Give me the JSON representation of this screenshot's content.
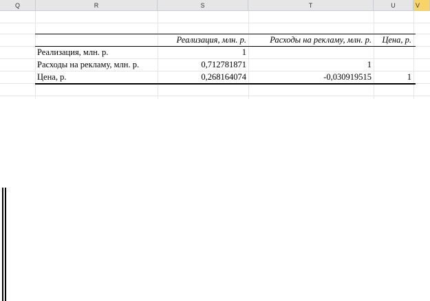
{
  "columns": [
    "Q",
    "R",
    "S",
    "T",
    "U",
    "V"
  ],
  "table": {
    "headers": [
      "",
      "Реализация, млн. р.",
      "Расходы на рекламу, млн. р.",
      "Цена, р."
    ],
    "rows": [
      {
        "label": "Реализация, млн. р.",
        "cells": [
          "1",
          "",
          ""
        ]
      },
      {
        "label": "Расходы на рекламу, млн. р.",
        "cells": [
          "0,712781871",
          "1",
          ""
        ]
      },
      {
        "label": "Цена, р.",
        "cells": [
          "0,268164074",
          "-0,030919515",
          "1"
        ]
      }
    ]
  },
  "colors": {
    "selected_column": "#f7d36a",
    "header_bg": "#e6e6e6",
    "grid": "#e3e6ea"
  }
}
